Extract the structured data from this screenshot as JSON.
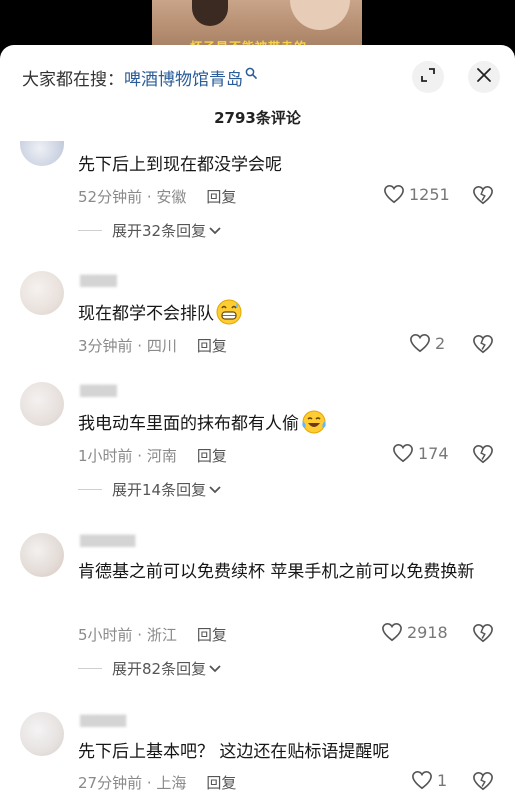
{
  "video": {
    "caption": "杯子是不能被带走的"
  },
  "search": {
    "prefix": "大家都在搜：",
    "term": "啤酒博物馆青岛",
    "icon": "search-icon"
  },
  "header": {
    "comment_count": "2793条评论",
    "expand_icon": "expand-icon",
    "close_icon": "close-icon"
  },
  "comments": [
    {
      "text": "先下后上到现在都没学会呢",
      "time": "52分钟前 · 安徽",
      "reply": "回复",
      "likes": "1251",
      "expand": "展开32条回复"
    },
    {
      "text": "现在都学不会排队",
      "emoji": "grinning-sweat-emoji",
      "time": "3分钟前 · 四川",
      "reply": "回复",
      "likes": "2"
    },
    {
      "text": "我电动车里面的抹布都有人偷",
      "emoji": "tears-of-joy-emoji",
      "time": "1小时前 · 河南",
      "reply": "回复",
      "likes": "174",
      "expand": "展开14条回复"
    },
    {
      "text": "肯德基之前可以免费续杯 苹果手机之前可以免费换新",
      "time": "5小时前 · 浙江",
      "reply": "回复",
      "likes": "2918",
      "expand": "展开82条回复"
    },
    {
      "text": "先下后上基本吧？ 这边还在贴标语提醒呢",
      "time": "27分钟前 · 上海",
      "reply": "回复",
      "likes": "1"
    }
  ]
}
